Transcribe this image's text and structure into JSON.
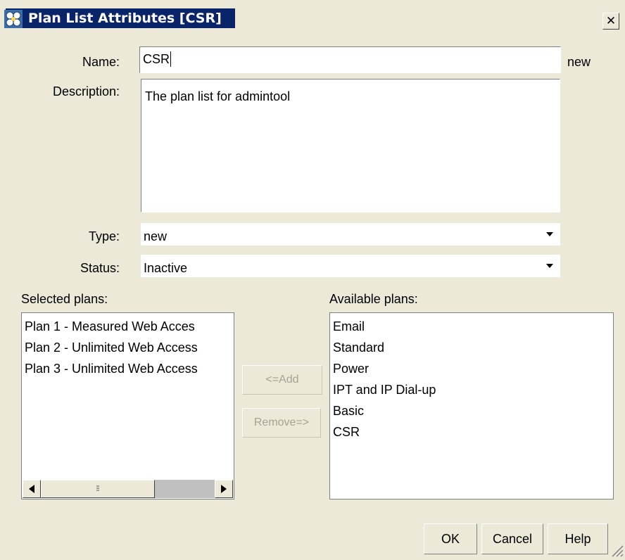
{
  "window": {
    "title": "Plan List Attributes [CSR]",
    "close_glyph": "✕",
    "icon": "app-globe-icon"
  },
  "form": {
    "name_label": "Name:",
    "name_value": "CSR",
    "name_status": "new",
    "description_label": "Description:",
    "description_value": "The plan list for admintool",
    "type_label": "Type:",
    "type_value": "new",
    "status_label": "Status:",
    "status_value": "Inactive"
  },
  "selected": {
    "label": "Selected plans:",
    "items": [
      "Plan 1 - Measured Web Acces",
      "Plan 2 - Unlimited Web Access",
      "Plan 3 - Unlimited Web Access"
    ]
  },
  "available": {
    "label": "Available plans:",
    "items": [
      "Email",
      "Standard",
      "Power",
      "IPT and IP Dial-up",
      "Basic",
      "CSR"
    ]
  },
  "transfer": {
    "add_label": "<=Add",
    "remove_label": "Remove=>"
  },
  "footer": {
    "ok_label": "OK",
    "cancel_label": "Cancel",
    "help_label": "Help"
  },
  "colors": {
    "title_bar": "#0a246a",
    "dialog_bg": "#ece9d8",
    "disabled_text": "#a6a395"
  }
}
